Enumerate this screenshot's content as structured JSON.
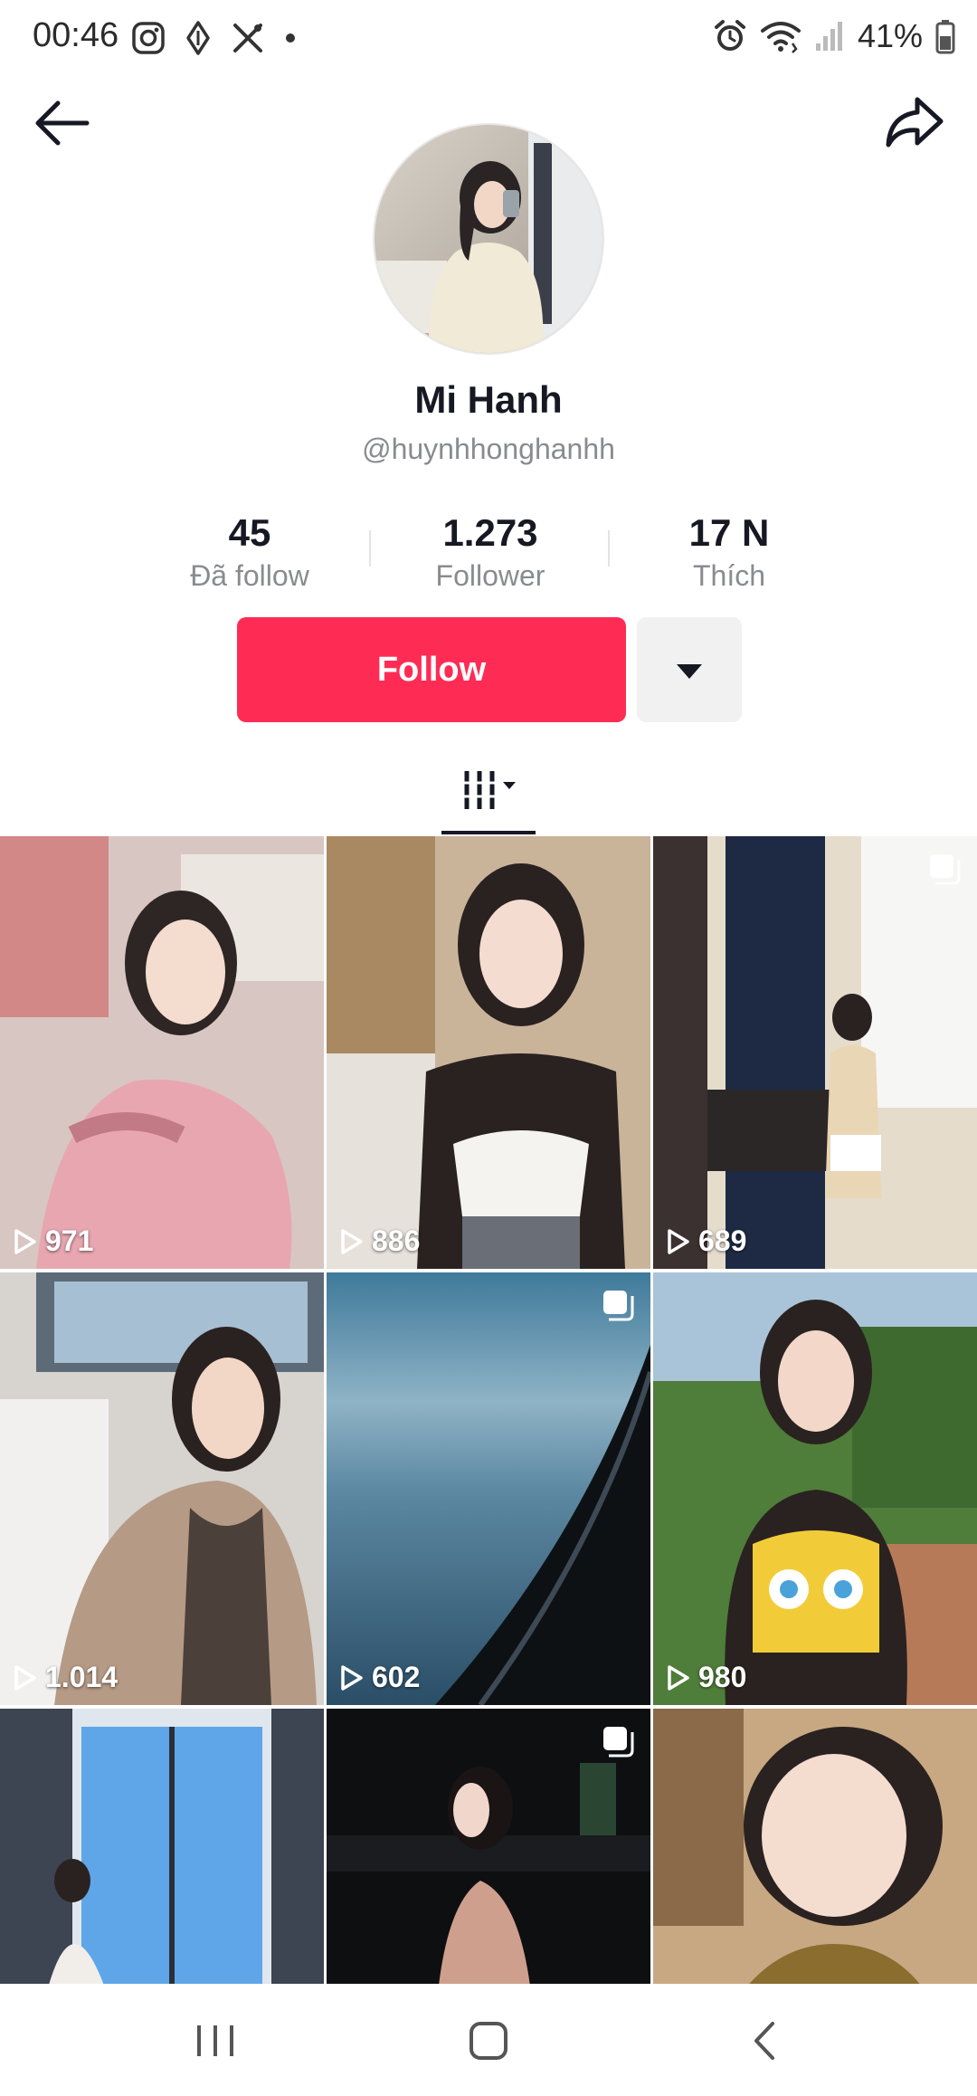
{
  "status_bar": {
    "time": "00:46",
    "battery": "41%"
  },
  "profile": {
    "name": "Mi Hanh",
    "handle": "@huynhhonghanhh"
  },
  "stats": [
    {
      "value": "45",
      "label": "Đã follow"
    },
    {
      "value": "1.273",
      "label": "Follower"
    },
    {
      "value": "17 N",
      "label": "Thích"
    }
  ],
  "actions": {
    "follow_label": "Follow"
  },
  "videos": [
    {
      "views": "971",
      "multi": false
    },
    {
      "views": "886",
      "multi": false
    },
    {
      "views": "689",
      "multi": true
    },
    {
      "views": "1.014",
      "multi": false
    },
    {
      "views": "602",
      "multi": true
    },
    {
      "views": "980",
      "multi": false
    },
    {
      "views": "",
      "multi": false
    },
    {
      "views": "",
      "multi": true
    },
    {
      "views": "",
      "multi": false
    }
  ],
  "colors": {
    "accent": "#fe2c55",
    "text": "#161823",
    "muted": "#8a8b91"
  }
}
